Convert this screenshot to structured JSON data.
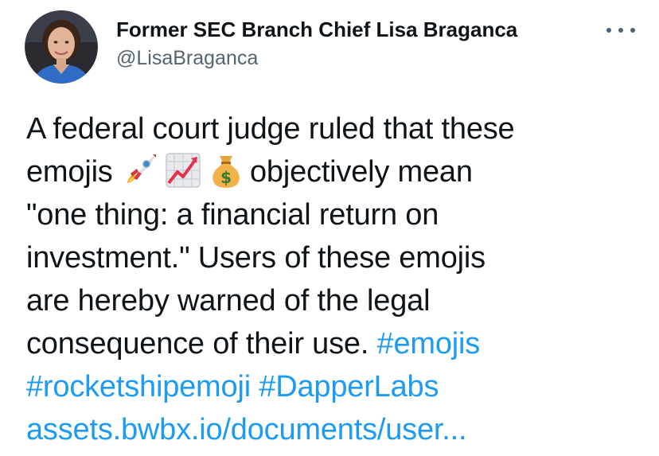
{
  "author": {
    "display_name": "Former SEC Branch Chief Lisa Braganca",
    "handle": "@LisaBraganca",
    "avatar_icon": "profile-photo"
  },
  "more_icon": "ellipsis-icon",
  "tweet": {
    "line1": "A federal court judge ruled that these",
    "line2_before": "emojis ",
    "emojis": [
      "rocket-emoji",
      "chart-increasing-emoji",
      "money-bag-emoji"
    ],
    "line2_after": "objectively mean",
    "line3": "\"one thing: a financial return on",
    "line4": "investment.\" Users of these emojis",
    "line5": "are hereby warned of the legal",
    "line6_text": "consequence of their use. ",
    "hashtag1": "#emojis",
    "hashtag2": "#rocketshipemoji",
    "hashtag3": "#DapperLabs",
    "url": "assets.bwbx.io/documents/user..."
  },
  "colors": {
    "text": "#0f1419",
    "secondary": "#536471",
    "link": "#1d9bf0"
  }
}
